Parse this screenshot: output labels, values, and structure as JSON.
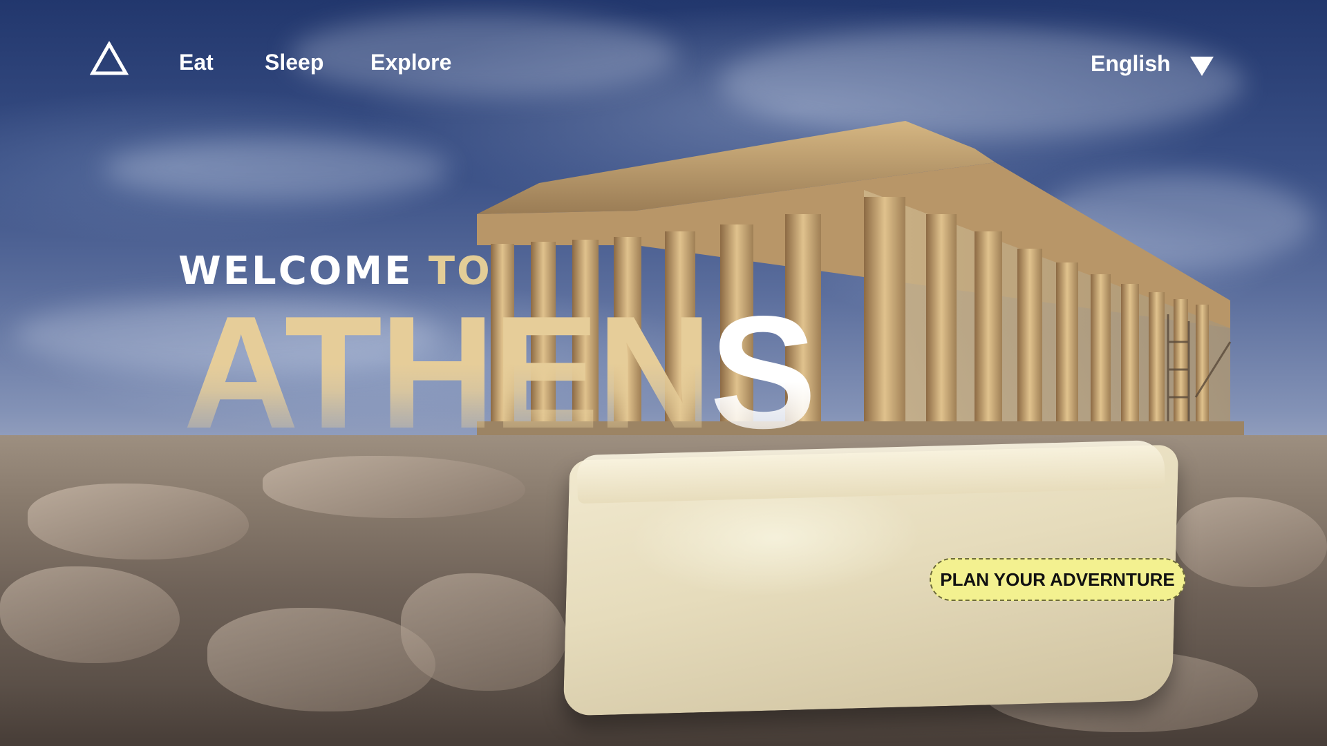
{
  "nav": {
    "logo_icon": "triangle-logo-icon",
    "links": [
      {
        "label": "Eat"
      },
      {
        "label": "Sleep"
      },
      {
        "label": "Explore"
      }
    ],
    "language": {
      "label": "English",
      "icon": "caret-down-icon"
    }
  },
  "hero": {
    "welcome_white": "WELCOME",
    "welcome_gold": "TO",
    "city_main": "ATHEN",
    "city_last": "S",
    "cta_label": "PLAN YOUR ADVERNTURE"
  },
  "colors": {
    "sky": "#2b3d73",
    "gold": "#e6cd99",
    "cta_bg": "#f3f190",
    "text_light": "#ffffff"
  },
  "background": {
    "scene": "parthenon-acropolis-photo"
  }
}
